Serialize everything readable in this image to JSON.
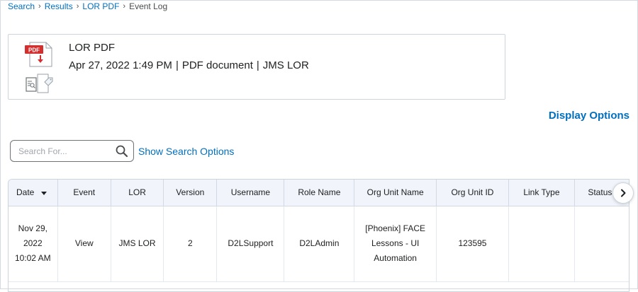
{
  "breadcrumb": {
    "items": [
      "Search",
      "Results",
      "LOR PDF"
    ],
    "current": "Event Log",
    "separator": "›"
  },
  "file": {
    "title": "LOR PDF",
    "date": "Apr 27, 2022 1:49 PM",
    "type": "PDF document",
    "owner": "JMS LOR",
    "divider": "|",
    "icon_label": "PDF"
  },
  "display_options_label": "Display Options",
  "search": {
    "placeholder": "Search For...",
    "show_options_label": "Show Search Options"
  },
  "table": {
    "columns": [
      "Date",
      "Event",
      "LOR",
      "Version",
      "Username",
      "Role Name",
      "Org Unit Name",
      "Org Unit ID",
      "Link Type",
      "Status Type"
    ],
    "rows": [
      {
        "date": "Nov 29, 2022 10:02 AM",
        "event": "View",
        "lor": "JMS LOR",
        "version": "2",
        "username": "D2LSupport",
        "role": "D2LAdmin",
        "org_unit_name": "[Phoenix] FACE Lessons - UI Automation",
        "org_unit_id": "123595",
        "link_type": "",
        "status_type": ""
      }
    ]
  },
  "colors": {
    "link": "#006fbf",
    "header_bg": "#f1f5fb",
    "pdf_red": "#d32f2f"
  }
}
